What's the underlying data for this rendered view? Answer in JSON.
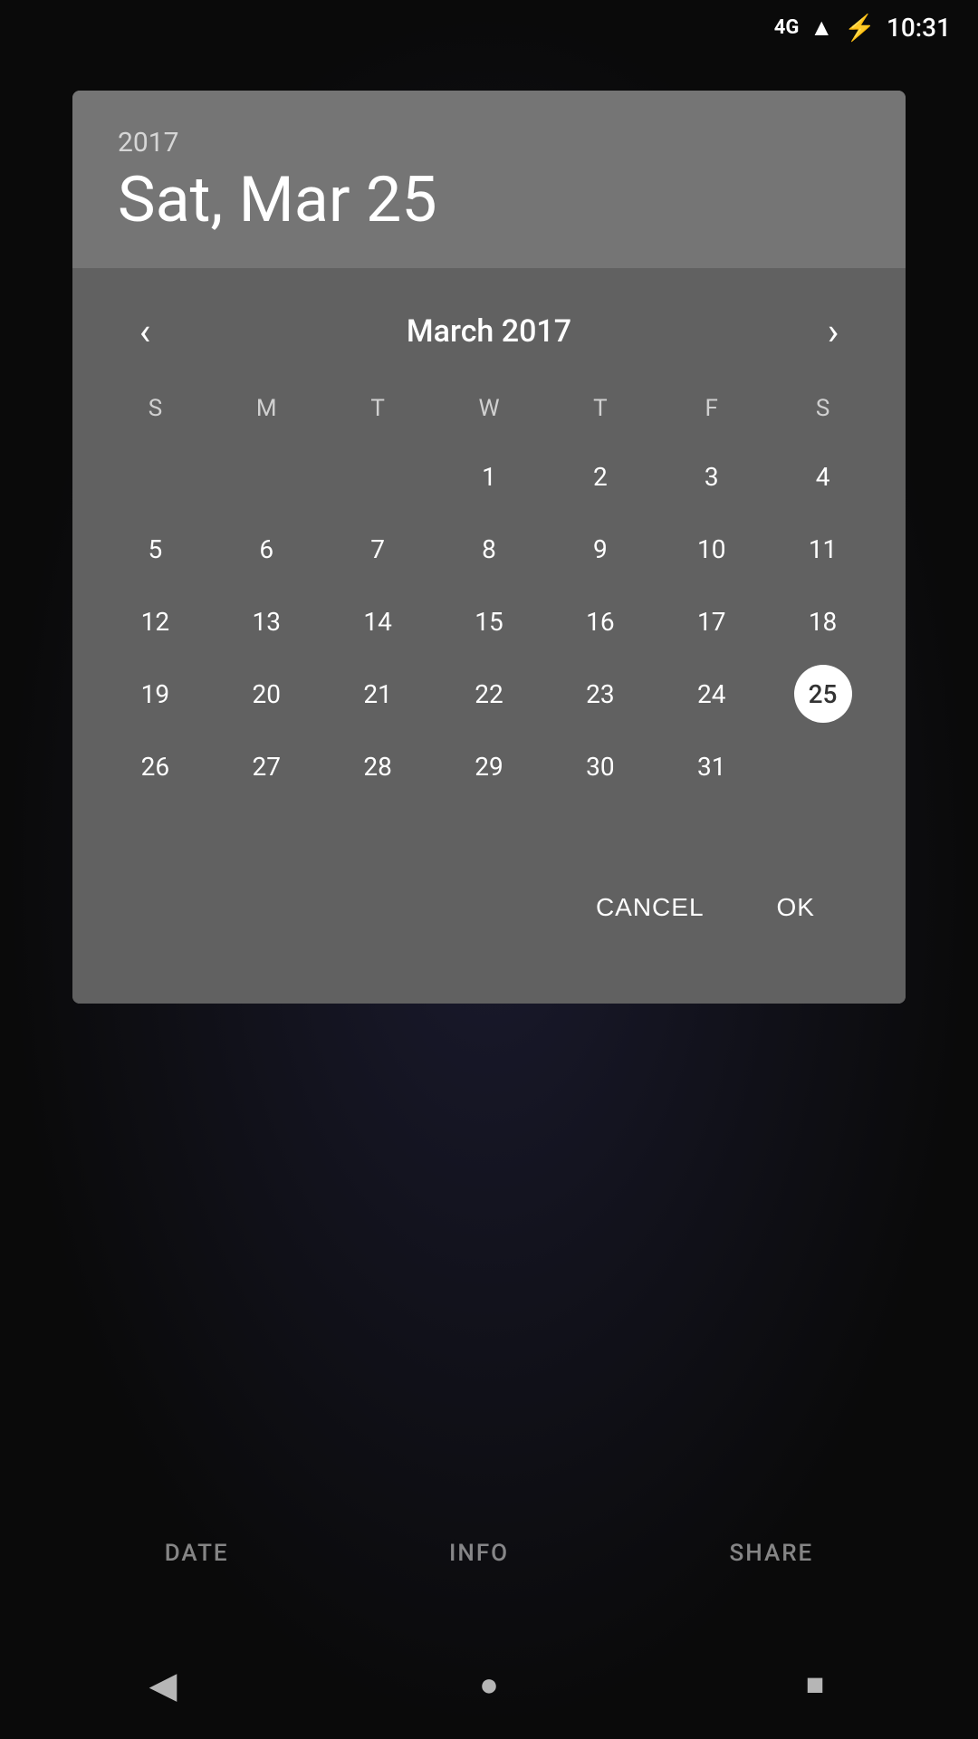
{
  "statusBar": {
    "network": "4G",
    "time": "10:31"
  },
  "dialog": {
    "year": "2017",
    "selectedDate": "Sat, Mar 25",
    "monthYear": "March 2017",
    "selectedDay": 25
  },
  "calendar": {
    "dayHeaders": [
      "S",
      "M",
      "T",
      "W",
      "T",
      "F",
      "S"
    ],
    "weeks": [
      [
        null,
        null,
        null,
        1,
        2,
        3,
        4
      ],
      [
        5,
        6,
        7,
        8,
        9,
        10,
        11
      ],
      [
        12,
        13,
        14,
        15,
        16,
        17,
        18
      ],
      [
        19,
        20,
        21,
        22,
        23,
        24,
        25
      ],
      [
        26,
        27,
        28,
        29,
        30,
        31,
        null
      ]
    ]
  },
  "buttons": {
    "cancel": "CANCEL",
    "ok": "OK"
  },
  "bottomTabs": {
    "date": "DATE",
    "info": "INFO",
    "share": "SHARE"
  },
  "nav": {
    "back": "◀",
    "home": "●",
    "recent": "■"
  }
}
